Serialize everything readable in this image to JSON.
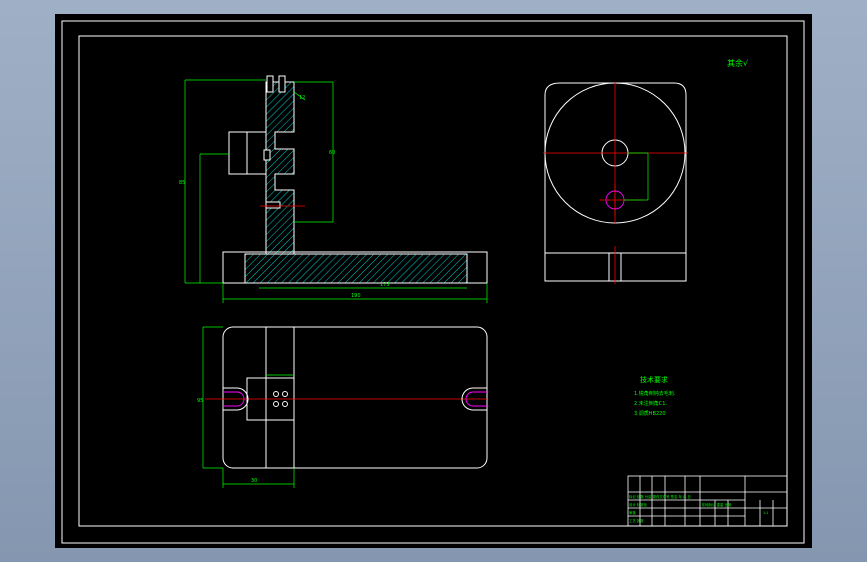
{
  "colors": {
    "frame": "#ffffff",
    "dimension": "#00ff00",
    "centerline": "#ff0000",
    "hatch": "#00ffff",
    "hidden": "#ff00ff",
    "background": "#000000"
  },
  "roughness_note": "其余√",
  "technical_requirements": {
    "title": "技术要求",
    "lines": [
      "1.锐角倒钝去毛刺.",
      "2.未注倒角C1.",
      "3.调质HB220"
    ]
  },
  "dimension_labels": {
    "front_overall_width": "190",
    "front_base_length": "173",
    "front_total_height": "85",
    "front_upright_height": "60",
    "front_top": "12",
    "top_view_height": "95",
    "top_view_bottom": "30"
  },
  "title_block": {
    "rows": [
      "标记 处数 分区 更改文件号 签名 年.月.日",
      "设计 标准化",
      "审核",
      "工艺 批准"
    ],
    "stage_label": "阶段标记 重量 比例",
    "scale": "1:1"
  }
}
